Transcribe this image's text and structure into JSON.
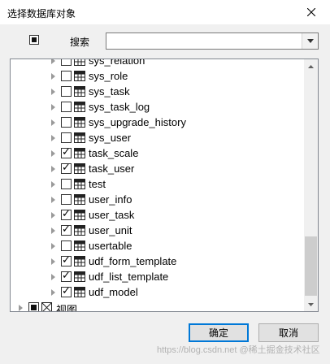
{
  "window": {
    "title": "选择数据库对象",
    "close_icon": "close-icon"
  },
  "toolbar": {
    "search_label": "搜索",
    "search_value": "",
    "all_checked": true
  },
  "tree": {
    "items": [
      {
        "label": "sys_relation",
        "checked": false,
        "level": 2
      },
      {
        "label": "sys_role",
        "checked": false,
        "level": 2
      },
      {
        "label": "sys_task",
        "checked": false,
        "level": 2
      },
      {
        "label": "sys_task_log",
        "checked": false,
        "level": 2
      },
      {
        "label": "sys_upgrade_history",
        "checked": false,
        "level": 2
      },
      {
        "label": "sys_user",
        "checked": false,
        "level": 2
      },
      {
        "label": "task_scale",
        "checked": true,
        "level": 2
      },
      {
        "label": "task_user",
        "checked": true,
        "level": 2
      },
      {
        "label": "test",
        "checked": false,
        "level": 2
      },
      {
        "label": "user_info",
        "checked": false,
        "level": 2
      },
      {
        "label": "user_task",
        "checked": true,
        "level": 2
      },
      {
        "label": "user_unit",
        "checked": true,
        "level": 2
      },
      {
        "label": "usertable",
        "checked": false,
        "level": 2
      },
      {
        "label": "udf_form_template",
        "checked": true,
        "level": 2
      },
      {
        "label": "udf_list_template",
        "checked": true,
        "level": 2
      },
      {
        "label": "udf_model",
        "checked": true,
        "level": 2
      },
      {
        "label": "视图",
        "checked": "partial",
        "level": 1,
        "icon": "view"
      }
    ]
  },
  "buttons": {
    "ok": "确定",
    "cancel": "取消"
  },
  "watermark": "https://blog.csdn.net @稀土掘金技术社区",
  "colors": {
    "accent": "#0078d7",
    "thumb": "#cdcdcd"
  }
}
